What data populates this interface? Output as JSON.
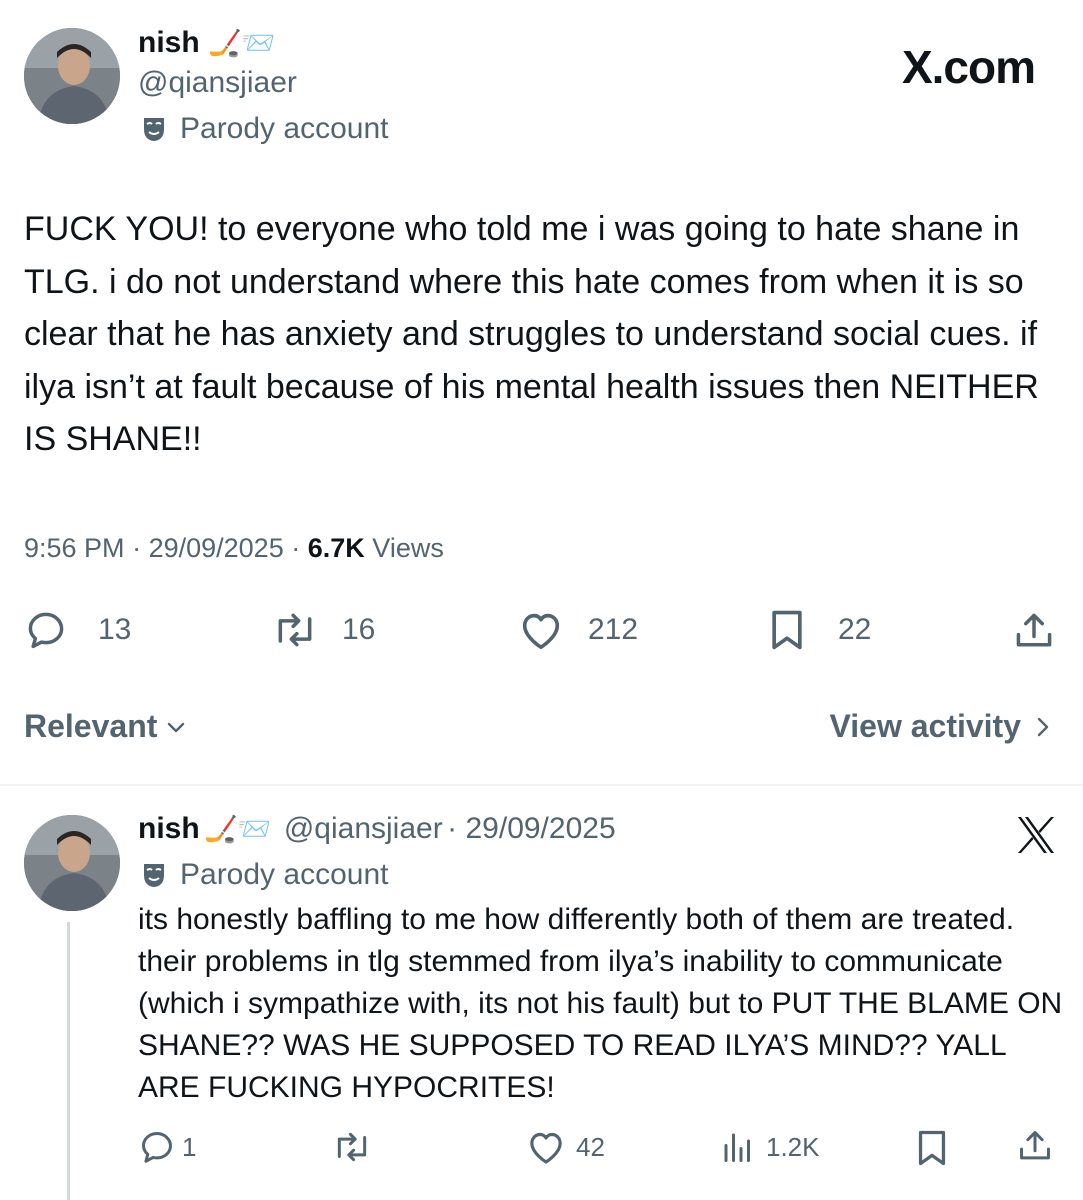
{
  "main_tweet": {
    "author_name": "nish",
    "author_emoji": "🏒📨",
    "handle": "@qiansjiaer",
    "badge_label": "Parody account",
    "brand": "X.com",
    "text": "FUCK YOU! to everyone who told me i was going to hate shane in TLG. i do not understand where this hate comes from when it is so clear that he has anxiety and struggles to understand social cues. if ilya isn’t at fault because of his mental health issues then NEITHER IS SHANE!!",
    "time": "9:56 PM",
    "date": "29/09/2025",
    "views_count": "6.7K",
    "views_label": "Views",
    "replies": "13",
    "reposts": "16",
    "likes": "212",
    "bookmarks": "22"
  },
  "sort": {
    "label": "Relevant",
    "activity_label": "View activity"
  },
  "reply": {
    "author_name": "nish",
    "author_emoji": "🏒📨",
    "handle": "@qiansjiaer",
    "date": "29/09/2025",
    "badge_label": "Parody account",
    "text": "its honestly baffling to me how differently both of them are treated. their problems in tlg stemmed from ilya’s inability to communicate (which i sympathize with, its not his fault) but to PUT THE BLAME ON SHANE?? WAS HE SUPPOSED TO READ ILYA’S MIND?? YALL ARE FUCKING HYPOCRITES!",
    "replies": "1",
    "likes": "42",
    "views": "1.2K"
  },
  "colors": {
    "text": "#0f1419",
    "secondary": "#536471",
    "divider": "#eff3f4"
  }
}
